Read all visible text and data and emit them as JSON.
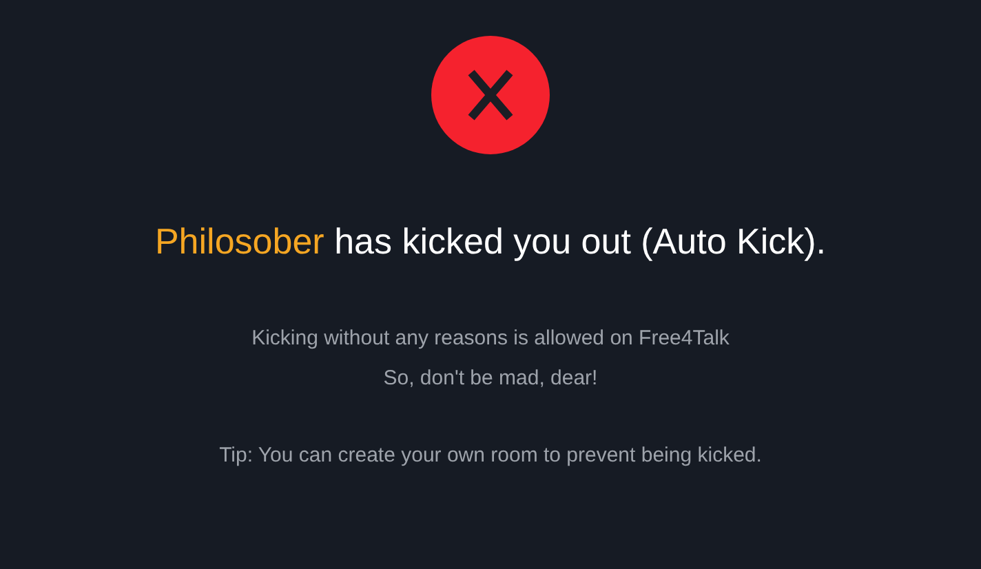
{
  "heading": {
    "user": "Philosober",
    "message": "has kicked you out (Auto Kick)."
  },
  "lines": [
    "Kicking without any reasons is allowed on Free4Talk",
    "So, don't be mad, dear!"
  ],
  "tip": "Tip: You can create your own room to prevent being kicked."
}
